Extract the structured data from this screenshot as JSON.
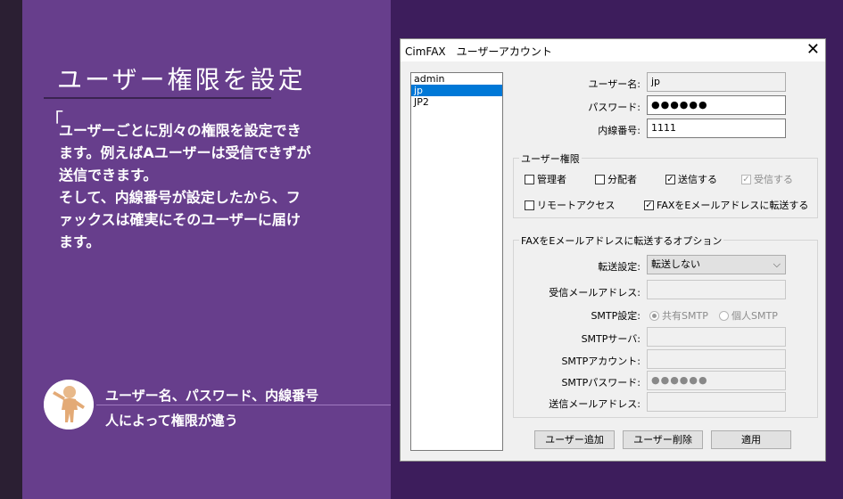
{
  "slide": {
    "title": "ユーザー権限を設定",
    "quote_mark": "「",
    "description": [
      "ユーザーごとに別々の権限を設定でき",
      "ます。例えばAユーザーは受信できずが",
      "送信できます。",
      "そして、内線番号が設定したから、フ",
      "ァックスは確実にそのユーザーに届け",
      "ます。"
    ],
    "caption_line1": "ユーザー名、パスワード、内線番号",
    "caption_line2": "人によって権限が違う"
  },
  "dialog": {
    "title": "CimFAX　ユーザーアカウント",
    "close_label": "✕",
    "users": [
      "admin",
      "jp",
      "JP2"
    ],
    "selected_user_index": 1,
    "username_label": "ユーザー名:",
    "username_value": "jp",
    "password_label": "パスワード:",
    "password_value": "●●●●●●",
    "extension_label": "内線番号:",
    "extension_value": "1111",
    "permissions": {
      "group_title": "ユーザー権限",
      "admin_label": "管理者",
      "admin_checked": false,
      "distributor_label": "分配者",
      "distributor_checked": false,
      "send_label": "送信する",
      "send_checked": true,
      "receive_label": "受信する",
      "receive_checked": true,
      "remote_label": "リモートアクセス",
      "remote_checked": false,
      "forward_label": "FAXをEメールアドレスに転送する",
      "forward_checked": true
    },
    "forward_options": {
      "group_title": "FAXをEメールアドレスに転送するオプション",
      "forward_setting_label": "転送設定:",
      "forward_setting_value": "転送しない",
      "receive_mail_label": "受信メールアドレス:",
      "receive_mail_value": "",
      "smtp_setting_label": "SMTP設定:",
      "smtp_shared_label": "共有SMTP",
      "smtp_personal_label": "個人SMTP",
      "smtp_selected": "shared",
      "smtp_server_label": "SMTPサーバ:",
      "smtp_server_value": "",
      "smtp_account_label": "SMTPアカウント:",
      "smtp_account_value": "",
      "smtp_password_label": "SMTPパスワード:",
      "smtp_password_value": "●●●●●●",
      "send_mail_label": "送信メールアドレス:",
      "send_mail_value": ""
    },
    "buttons": {
      "add_user": "ユーザー追加",
      "delete_user": "ユーザー削除",
      "apply": "適用"
    }
  },
  "colors": {
    "slide_bg": "#673e8c",
    "outer_bg": "#3d1d5c",
    "selection": "#0078d7"
  }
}
